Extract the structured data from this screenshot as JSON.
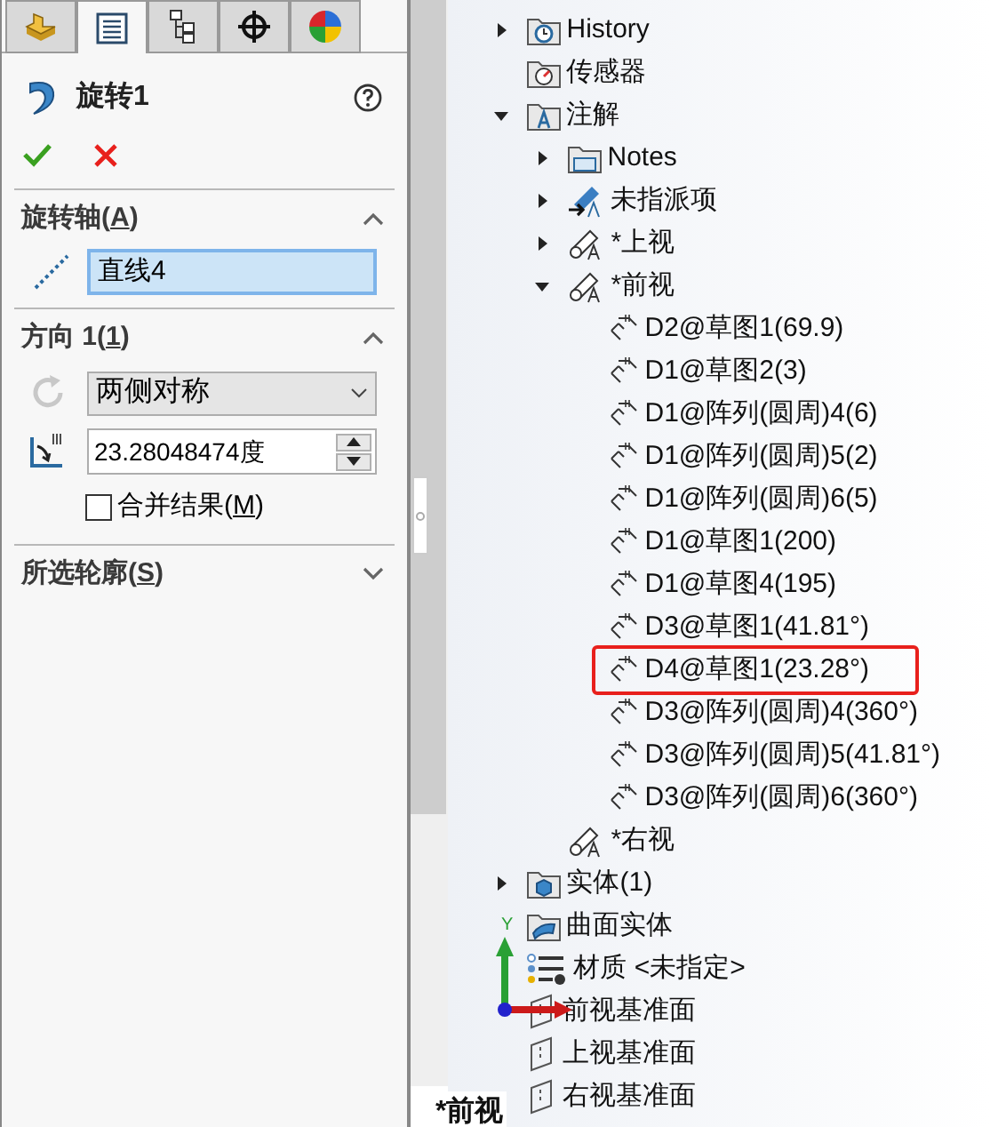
{
  "property_tabs": [
    {
      "kind": "feature",
      "selected": false
    },
    {
      "kind": "property",
      "selected": true
    },
    {
      "kind": "config",
      "selected": false
    },
    {
      "kind": "dimxpert",
      "selected": false
    },
    {
      "kind": "display",
      "selected": false
    }
  ],
  "feature": {
    "title": "旋转1"
  },
  "sections": [
    {
      "label_before": "旋转轴(",
      "mnemonic": "A",
      "label_after": ")",
      "expanded": true,
      "kind": "axis",
      "field": {
        "value": "直线4",
        "selected": true
      }
    },
    {
      "label_before": "方向 1(",
      "mnemonic": "1",
      "label_after": ")",
      "expanded": true,
      "kind": "direction",
      "dropdown": {
        "value": "两侧对称"
      },
      "angle": {
        "value": "23.28048474度"
      },
      "merge": {
        "label_before": "合并结果(",
        "mnemonic": "M",
        "label_after": ")",
        "checked": false
      }
    },
    {
      "label_before": "所选轮廓(",
      "mnemonic": "S",
      "label_after": ")",
      "expanded": false
    }
  ],
  "tree": [
    {
      "label": "History",
      "kind": "history",
      "expanded": false
    },
    {
      "label": "传感器",
      "kind": "sensor"
    },
    {
      "label": "注解",
      "kind": "annotations",
      "expanded": true,
      "children": [
        {
          "label": "Notes",
          "kind": "notes",
          "expanded": false
        },
        {
          "label": "未指派项",
          "kind": "unassigned",
          "expanded": false
        },
        {
          "label": "*上视",
          "kind": "view",
          "expanded": false
        },
        {
          "label": "*前视",
          "kind": "view",
          "expanded": true,
          "children": [
            {
              "label": "D2@草图1(69.9)",
              "kind": "dimension",
              "highlighted": false
            },
            {
              "label": "D1@草图2(3)",
              "kind": "dimension",
              "highlighted": false
            },
            {
              "label": "D1@阵列(圆周)4(6)",
              "kind": "dimension",
              "highlighted": false
            },
            {
              "label": "D1@阵列(圆周)5(2)",
              "kind": "dimension",
              "highlighted": false
            },
            {
              "label": "D1@阵列(圆周)6(5)",
              "kind": "dimension",
              "highlighted": false
            },
            {
              "label": "D1@草图1(200)",
              "kind": "dimension",
              "highlighted": false
            },
            {
              "label": "D1@草图4(195)",
              "kind": "dimension",
              "highlighted": false
            },
            {
              "label": "D3@草图1(41.81°)",
              "kind": "dimension",
              "highlighted": false
            },
            {
              "label": "D4@草图1(23.28°)",
              "kind": "dimension",
              "highlighted": true
            },
            {
              "label": "D3@阵列(圆周)4(360°)",
              "kind": "dimension",
              "highlighted": false
            },
            {
              "label": "D3@阵列(圆周)5(41.81°)",
              "kind": "dimension",
              "highlighted": false
            },
            {
              "label": "D3@阵列(圆周)6(360°)",
              "kind": "dimension",
              "highlighted": false
            }
          ]
        },
        {
          "label": "*右视",
          "kind": "view"
        }
      ]
    },
    {
      "label": "实体(1)",
      "kind": "solid",
      "expanded": false
    },
    {
      "label": "曲面实体",
      "kind": "surface"
    },
    {
      "label": "材质 <未指定>",
      "kind": "material"
    },
    {
      "label": "前视基准面",
      "kind": "plane"
    },
    {
      "label": "上视基准面",
      "kind": "plane"
    },
    {
      "label": "右视基准面",
      "kind": "plane"
    }
  ],
  "triad": {
    "y_label": "Y"
  },
  "view_label": "*前视"
}
